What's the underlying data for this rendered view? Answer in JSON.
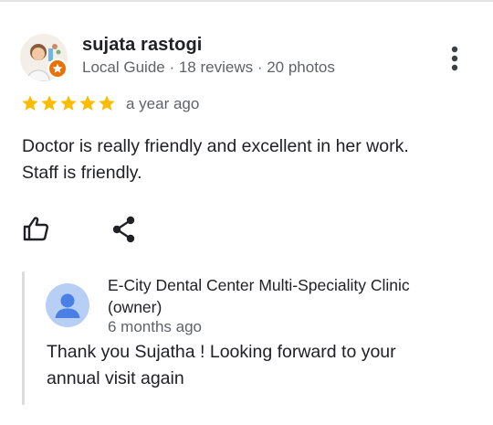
{
  "review": {
    "reviewer_name": "sujata rastogi",
    "reviewer_meta": "Local Guide · 18 reviews · 20 photos",
    "rating": 5,
    "rating_max": 5,
    "star_color": "#fbbc04",
    "time": "a year ago",
    "text_line1": "Doctor is really friendly and excellent in her work.",
    "text_line2": "Staff is friendly.",
    "icons": {
      "avatar": "reviewer-avatar",
      "badge": "local-guide-badge-icon",
      "more": "more-vert-icon",
      "like": "thumbs-up-icon",
      "share": "share-icon"
    }
  },
  "owner_response": {
    "name_line1": "E-City Dental Center Multi-Speciality Clinic",
    "name_line2": "(owner)",
    "time": "6 months ago",
    "text_line1": "Thank you Sujatha ! Looking forward to your",
    "text_line2": "annual visit again",
    "avatar_color": "#4a7fe3"
  }
}
